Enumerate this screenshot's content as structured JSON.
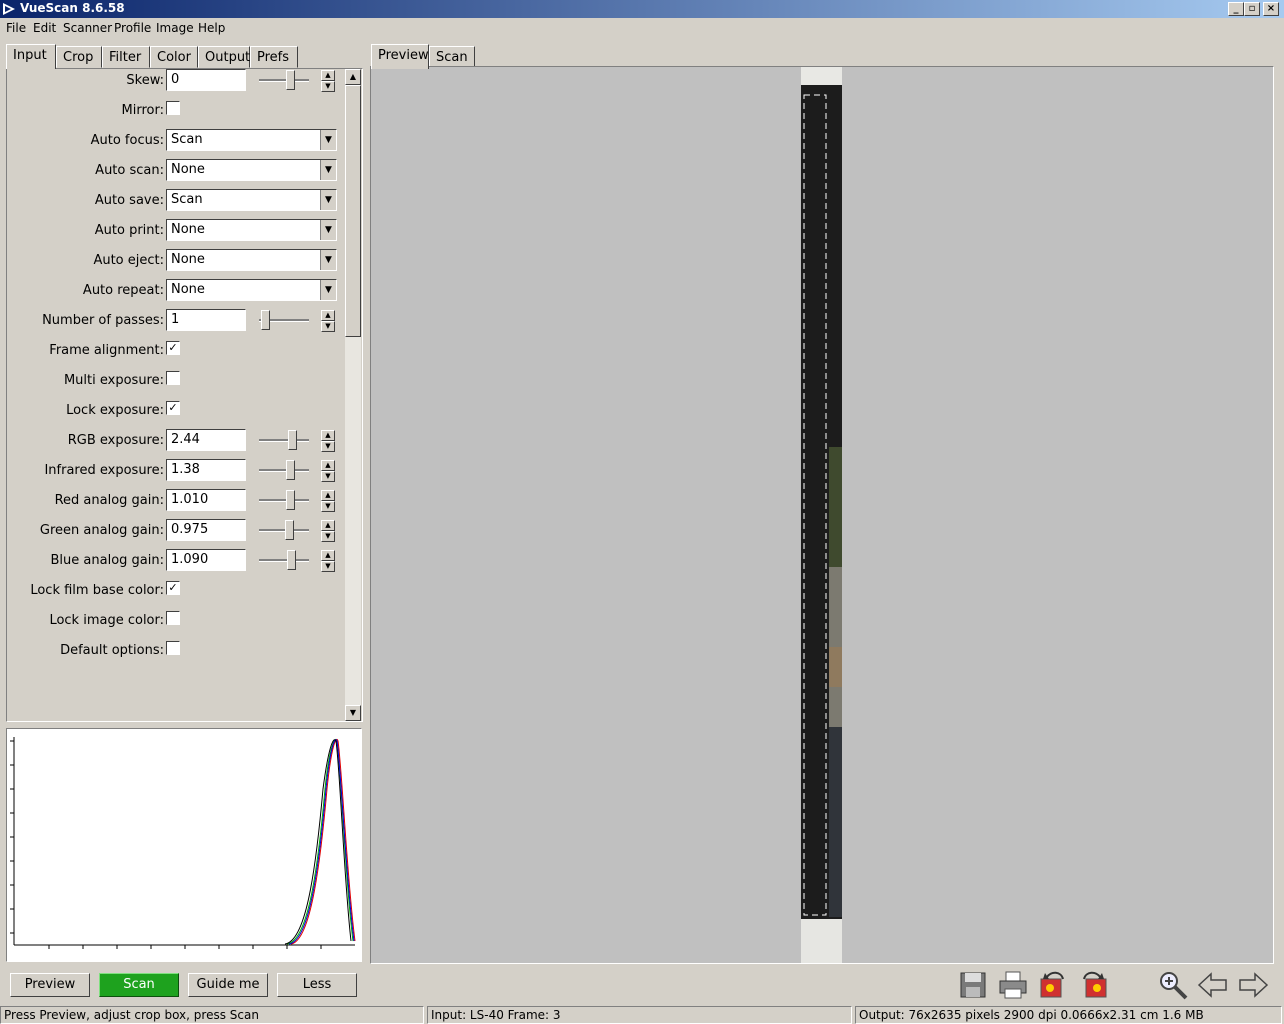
{
  "window": {
    "title": "VueScan 8.6.58"
  },
  "menu": [
    "File",
    "Edit",
    "Scanner",
    "Profile",
    "Image",
    "Help"
  ],
  "left_tabs": [
    "Input",
    "Crop",
    "Filter",
    "Color",
    "Output",
    "Prefs"
  ],
  "right_tabs": [
    "Preview",
    "Scan"
  ],
  "options": {
    "skew": {
      "label": "Skew:",
      "value": "0"
    },
    "mirror": {
      "label": "Mirror:",
      "checked": false
    },
    "auto_focus": {
      "label": "Auto focus:",
      "value": "Scan"
    },
    "auto_scan": {
      "label": "Auto scan:",
      "value": "None"
    },
    "auto_save": {
      "label": "Auto save:",
      "value": "Scan"
    },
    "auto_print": {
      "label": "Auto print:",
      "value": "None"
    },
    "auto_eject": {
      "label": "Auto eject:",
      "value": "None"
    },
    "auto_repeat": {
      "label": "Auto repeat:",
      "value": "None"
    },
    "number_of_passes": {
      "label": "Number of passes:",
      "value": "1"
    },
    "frame_alignment": {
      "label": "Frame alignment:",
      "checked": true
    },
    "multi_exposure": {
      "label": "Multi exposure:",
      "checked": false
    },
    "lock_exposure": {
      "label": "Lock exposure:",
      "checked": true
    },
    "rgb_exposure": {
      "label": "RGB exposure:",
      "value": "2.44"
    },
    "infrared_exposure": {
      "label": "Infrared exposure:",
      "value": "1.38"
    },
    "red_analog_gain": {
      "label": "Red analog gain:",
      "value": "1.010"
    },
    "green_analog_gain": {
      "label": "Green analog gain:",
      "value": "0.975"
    },
    "blue_analog_gain": {
      "label": "Blue analog gain:",
      "value": "1.090"
    },
    "lock_film_base_color": {
      "label": "Lock film base color:",
      "checked": true
    },
    "lock_image_color": {
      "label": "Lock image color:",
      "checked": false
    },
    "default_options": {
      "label": "Default options:",
      "checked": false
    }
  },
  "buttons": {
    "preview": "Preview",
    "scan": "Scan",
    "guide_me": "Guide me",
    "less": "Less"
  },
  "toolbar_icons": [
    "save-icon",
    "print-icon",
    "rotate-left-icon",
    "rotate-right-icon",
    "zoom-in-icon",
    "previous-arrow-icon",
    "next-arrow-icon"
  ],
  "status": {
    "hint": "Press Preview, adjust crop box, press Scan",
    "input": "Input: LS-40 Frame: 3",
    "output": "Output: 76x2635 pixels 2900 dpi 0.0666x2.31 cm 1.6 MB"
  },
  "colors": {
    "scan_button": "#1ea21e",
    "preview_bg": "#c0c0c0",
    "titlebar": "#0a246a"
  }
}
